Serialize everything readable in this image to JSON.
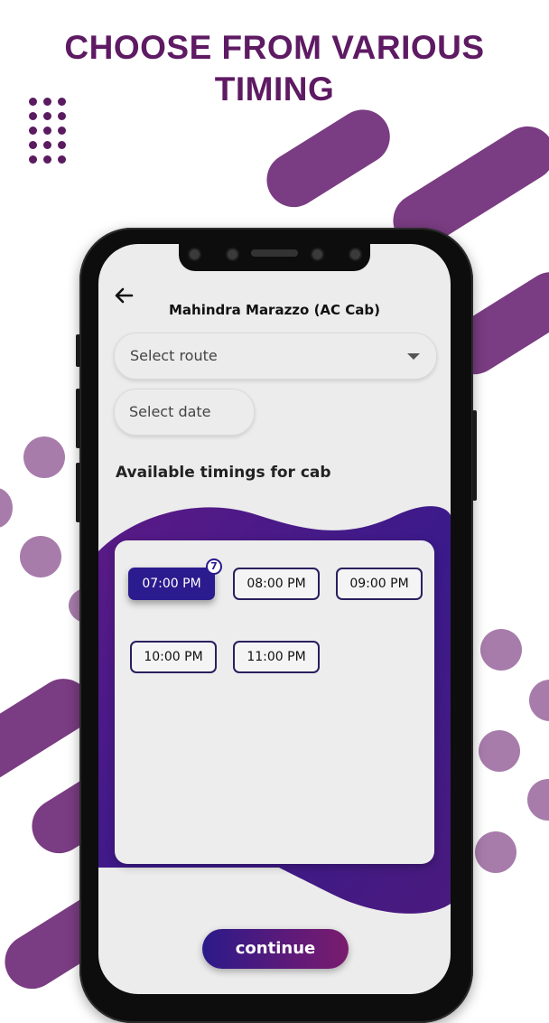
{
  "promo": {
    "headline_line1": "CHOOSE FROM VARIOUS",
    "headline_line2": "TIMING"
  },
  "screen": {
    "title": "Mahindra Marazzo (AC Cab)",
    "route_placeholder": "Select route",
    "date_placeholder": "Select date",
    "section_heading": "Available timings for cab",
    "timings": [
      "07:00 PM",
      "08:00 PM",
      "09:00 PM",
      "10:00 PM",
      "11:00 PM"
    ],
    "selected_timing": "07:00 PM",
    "selected_badge": "7",
    "continue_label": "continue"
  },
  "colors": {
    "brand_purple": "#5e1a63",
    "selected_blue": "#2a1b8e",
    "accent_stripe": "#7a3c82",
    "accent_circle": "#a77cab"
  },
  "icons": [
    "back-arrow-icon",
    "chevron-down-icon"
  ]
}
